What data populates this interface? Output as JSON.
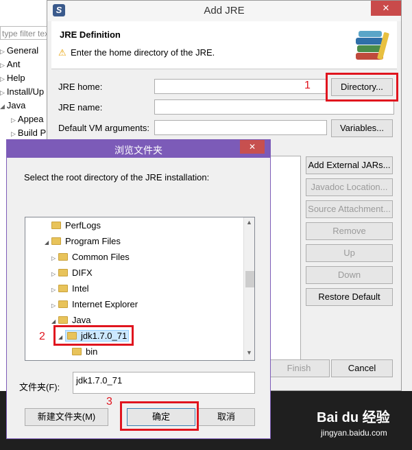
{
  "preferences": {
    "filter_placeholder": "type filter tex",
    "tree": [
      {
        "label": "General",
        "expanded": false
      },
      {
        "label": "Ant",
        "expanded": false
      },
      {
        "label": "Help",
        "expanded": false
      },
      {
        "label": "Install/Up",
        "expanded": false
      },
      {
        "label": "Java",
        "expanded": true
      },
      {
        "label": "Appea",
        "expanded": false
      },
      {
        "label": "Build P",
        "expanded": false
      }
    ]
  },
  "add_jre": {
    "title": "Add JRE",
    "close_glyph": "✕",
    "header_title": "JRE Definition",
    "header_message": "Enter the home directory of the JRE.",
    "jre_home_label": "JRE home:",
    "jre_home_value": "",
    "jre_name_label": "JRE name:",
    "jre_name_value": "",
    "vm_args_label": "Default VM arguments:",
    "vm_args_value": "",
    "directory_button": "Directory...",
    "variables_button": "Variables...",
    "add_external_jars_button": "Add External JARs...",
    "javadoc_location_button": "Javadoc Location...",
    "source_attachment_button": "Source Attachment...",
    "remove_button": "Remove",
    "up_button": "Up",
    "down_button": "Down",
    "restore_default_button": "Restore Default",
    "finish_button": "Finish",
    "cancel_button": "Cancel"
  },
  "browse_folder": {
    "title": "浏览文件夹",
    "close_glyph": "✕",
    "message": "Select the root directory of the JRE installation:",
    "tree": [
      {
        "label": "PerfLogs",
        "expanded": null,
        "selected": false
      },
      {
        "label": "Program Files",
        "expanded": true,
        "selected": false
      },
      {
        "label": "Common Files",
        "expanded": false,
        "selected": false
      },
      {
        "label": "DIFX",
        "expanded": false,
        "selected": false
      },
      {
        "label": "Intel",
        "expanded": false,
        "selected": false
      },
      {
        "label": "Internet Explorer",
        "expanded": false,
        "selected": false
      },
      {
        "label": "Java",
        "expanded": true,
        "selected": false
      },
      {
        "label": "jdk1.7.0_71",
        "expanded": true,
        "selected": true
      },
      {
        "label": "bin",
        "expanded": null,
        "selected": false
      }
    ],
    "folder_label": "文件夹(F):",
    "folder_value": "jdk1.7.0_71",
    "new_folder_button": "新建文件夹(M)",
    "ok_button": "确定",
    "cancel_button": "取消"
  },
  "annotations": {
    "step1": "1",
    "step2": "2",
    "step3": "3",
    "accent_color": "#e0141e"
  },
  "watermark": {
    "brand": "Bai du 经验",
    "url": "jingyan.baidu.com"
  }
}
